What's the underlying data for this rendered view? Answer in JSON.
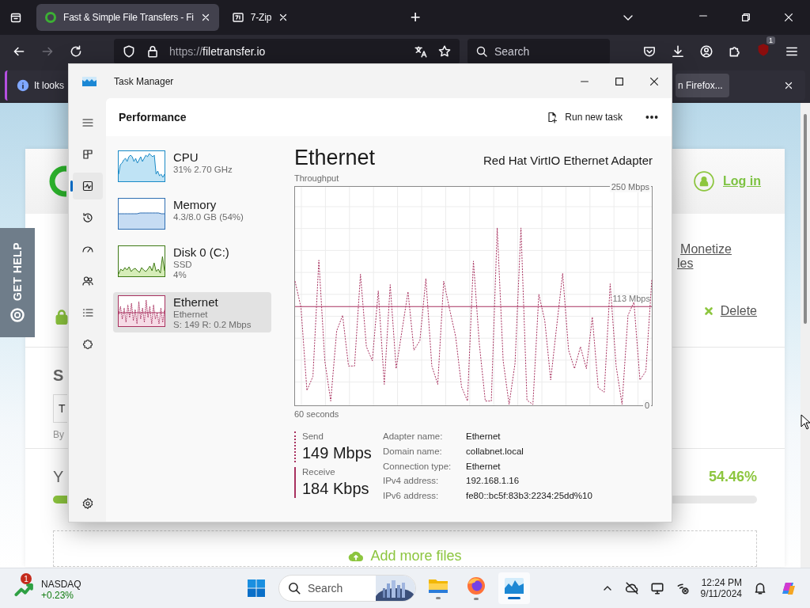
{
  "browser": {
    "tabs": [
      {
        "title": "Fast & Simple File Transfers - Fi",
        "selected": true,
        "kind": "site"
      },
      {
        "title": "7-Zip",
        "selected": false,
        "kind": "archive"
      }
    ],
    "new_tab": "+",
    "address": {
      "scheme": "https://",
      "host": "filetransfer.io"
    },
    "search": {
      "placeholder": "Search"
    },
    "extension_badge": "1",
    "notification": {
      "text": "It looks",
      "button": "n Firefox..."
    }
  },
  "page": {
    "get_help": "GET HELP",
    "login": "Log in",
    "links": [
      "Monetize",
      "les"
    ],
    "delete": "Delete",
    "share_heading": "S",
    "field_value": "T",
    "note": "By",
    "progress": {
      "label": "Y",
      "percent": "54.46%"
    },
    "add_files": "Add more files"
  },
  "task_manager": {
    "title": "Task Manager",
    "nav": [
      {
        "kind": "processes",
        "selected": false
      },
      {
        "kind": "performance",
        "selected": true
      },
      {
        "kind": "history",
        "selected": false
      },
      {
        "kind": "startup",
        "selected": false
      },
      {
        "kind": "users",
        "selected": false
      },
      {
        "kind": "details",
        "selected": false
      },
      {
        "kind": "services",
        "selected": false
      }
    ],
    "page_title": "Performance",
    "run_new_task": "Run new task",
    "devices": [
      {
        "kind": "cpu",
        "name": "CPU",
        "lines": [
          "31% 2.70 GHz"
        ],
        "selected": false
      },
      {
        "kind": "memory",
        "name": "Memory",
        "lines": [
          "4.3/8.0 GB (54%)"
        ],
        "selected": false
      },
      {
        "kind": "disk",
        "name": "Disk 0 (C:)",
        "lines": [
          "SSD",
          "4%"
        ],
        "selected": false
      },
      {
        "kind": "ethernet",
        "name": "Ethernet",
        "lines": [
          "Ethernet",
          "S: 149 R: 0.2 Mbps"
        ],
        "selected": true
      }
    ],
    "detail": {
      "title": "Ethernet",
      "adapter": "Red Hat VirtIO Ethernet Adapter",
      "time_label": "60 seconds",
      "chart_data": {
        "type": "line",
        "title": "Throughput",
        "grid": true,
        "ylim": [
          0,
          250
        ],
        "yticks": [
          {
            "value": 250,
            "label": "250 Mbps"
          },
          {
            "value": 0,
            "label": "0"
          }
        ],
        "ref_lines": [
          {
            "axis": "y",
            "value": 113,
            "label": "113 Mbps"
          }
        ],
        "categories": [
          null,
          null,
          null,
          null,
          null,
          null,
          null,
          null,
          null,
          null,
          null,
          null,
          null,
          null,
          null,
          null,
          null,
          null,
          null,
          null,
          null,
          null,
          null,
          null,
          null,
          null,
          null,
          null,
          null,
          null,
          null,
          null,
          null,
          null,
          null,
          null,
          null,
          null,
          null,
          null,
          null,
          null,
          null,
          null,
          null,
          null,
          null,
          null,
          null,
          null,
          null,
          null,
          null,
          null,
          null,
          null,
          null,
          null,
          null,
          null,
          null
        ],
        "series": [
          {
            "name": "Send",
            "color": "#a8315f",
            "line_style": "dashed",
            "values": [
              142,
              112,
              17,
              33,
              166,
              51,
              5,
              85,
              103,
              45,
              45,
              150,
              67,
              51,
              131,
              24,
              138,
              42,
              86,
              130,
              63,
              74,
              145,
              45,
              24,
              142,
              110,
              79,
              21,
              5,
              165,
              70,
              5,
              5,
              203,
              51,
              1,
              48,
              203,
              6,
              1,
              127,
              97,
              29,
              90,
              151,
              63,
              42,
              67,
              42,
              101,
              20,
              15,
              139,
              45,
              1,
              103,
              118,
              29,
              39,
              144
            ]
          }
        ]
      },
      "send": {
        "value": "149 Mbps"
      },
      "receive": {
        "label": "Receive",
        "value": "184 Kbps"
      },
      "properties": [
        {
          "key": "Adapter name:",
          "value": "Ethernet"
        },
        {
          "key": "Domain name:",
          "value": "collabnet.local"
        },
        {
          "key": "Connection type:",
          "value": "Ethernet"
        },
        {
          "key": "IPv4 address:",
          "value": "192.168.1.16"
        },
        {
          "key": "IPv6 address:",
          "value": "fe80::bc5f:83b3:2234:25dd%10"
        }
      ]
    }
  },
  "taskbar": {
    "widget": {
      "name": "NASDAQ",
      "change": "+0.23%",
      "badge": "1"
    },
    "search": {
      "placeholder": "Search"
    },
    "apps": [
      {
        "kind": "explorer",
        "selected": false
      },
      {
        "kind": "firefox",
        "selected": false
      },
      {
        "kind": "taskmanager",
        "selected": true
      }
    ],
    "clock": {
      "time": "12:24 PM",
      "date": "9/11/2024"
    }
  }
}
